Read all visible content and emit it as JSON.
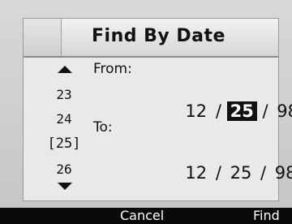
{
  "dialog": {
    "title": "Find By Date"
  },
  "picker": {
    "items": [
      "23",
      "24",
      "[25]",
      "26"
    ],
    "selected_index": 2
  },
  "from": {
    "label": "From:",
    "month": "12",
    "day": "25",
    "year": "98",
    "separator": "/"
  },
  "to": {
    "label": "To:",
    "month": "12",
    "day": "25",
    "year": "98",
    "separator": "/"
  },
  "softkeys": {
    "left": "Cancel",
    "right": "Find"
  }
}
